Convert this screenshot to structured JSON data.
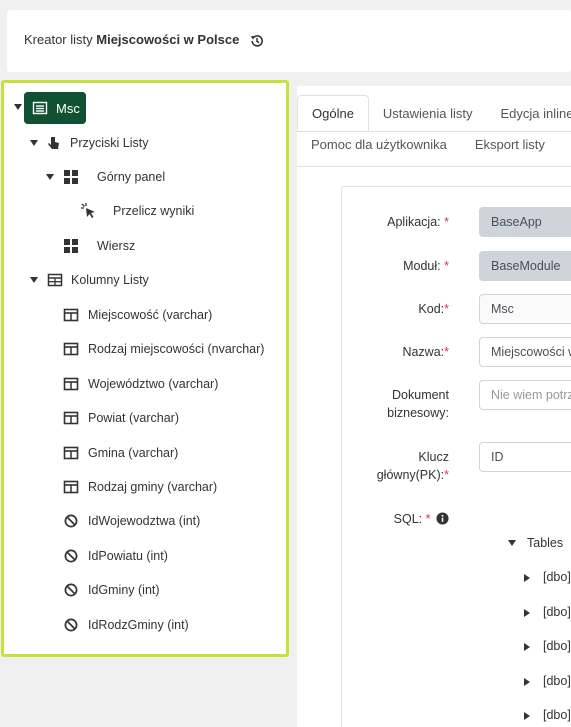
{
  "header": {
    "prefix": "Kreator listy",
    "title": "Miejscowości w Polsce",
    "history_icon": "history-icon"
  },
  "tree": {
    "root": {
      "label": "Msc",
      "icon": "list-icon"
    },
    "buttons_group": {
      "label": "Przyciski Listy",
      "icon": "pointer-hand-icon"
    },
    "top_panel": {
      "label": "Górny panel",
      "icon": "grid-icon"
    },
    "recalc": {
      "label": "Przelicz wyniki",
      "icon": "cursor-click-icon"
    },
    "row": {
      "label": "Wiersz",
      "icon": "grid-icon"
    },
    "columns_group": {
      "label": "Kolumny Listy",
      "icon": "table-icon"
    },
    "columns": [
      {
        "label": "Miejscowość (varchar)",
        "icon": "column-icon"
      },
      {
        "label": "Rodzaj miejscowości (nvarchar)",
        "icon": "column-icon"
      },
      {
        "label": "Województwo (varchar)",
        "icon": "column-icon"
      },
      {
        "label": "Powiat (varchar)",
        "icon": "column-icon"
      },
      {
        "label": "Gmina (varchar)",
        "icon": "column-icon"
      },
      {
        "label": "Rodzaj gminy (varchar)",
        "icon": "column-icon"
      },
      {
        "label": "IdWojewodztwa (int)",
        "icon": "ban-icon"
      },
      {
        "label": "IdPowiatu (int)",
        "icon": "ban-icon"
      },
      {
        "label": "IdGminy (int)",
        "icon": "ban-icon"
      },
      {
        "label": "IdRodzGminy (int)",
        "icon": "ban-icon"
      }
    ]
  },
  "tabs": {
    "row1": [
      "Ogólne",
      "Ustawienia listy",
      "Edycja inline"
    ],
    "row2": [
      "Pomoc dla użytkownika",
      "Eksport listy"
    ],
    "active": "Ogólne"
  },
  "form": {
    "app_label": "Aplikacja:",
    "app_value": "BaseApp",
    "module_label": "Moduł:",
    "module_value": "BaseModule",
    "code_label": "Kod:",
    "code_value": "Msc",
    "name_label": "Nazwa:",
    "name_value": "Miejscowości w Polsce",
    "doc_label_1": "Dokument",
    "doc_label_2": "biznesowy:",
    "doc_placeholder": "Nie wiem potrzebuję pomocy",
    "pk_label_1": "Klucz",
    "pk_label_2": "główny(PK):",
    "pk_value": "ID",
    "sql_label": "SQL:",
    "required_mark": "*",
    "info_icon": "info-circle-icon"
  },
  "sql_tree": {
    "root": "Tables",
    "items": [
      "[dbo]",
      "[dbo]",
      "[dbo]",
      "[dbo]",
      "[dbo]"
    ]
  },
  "colors": {
    "accent_green": "#0f5132",
    "highlight_border": "#c6e03e",
    "required": "#dc3545"
  }
}
